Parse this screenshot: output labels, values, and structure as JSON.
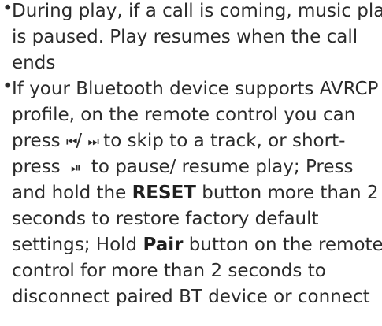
{
  "bullet_symbol": "•",
  "item1": {
    "line1": "During play, if a call is coming, music play",
    "line2": "is paused. Play resumes when the call",
    "line3": "ends"
  },
  "item2": {
    "line1": "If your Bluetooth device supports AVRCP",
    "line2": "profile, on the remote control you can",
    "line3_pre": "press ",
    "icon_prev": "⏮",
    "line3_slash": "/ ",
    "icon_next": "⏭",
    "line3_post": " to skip to a track, or short-",
    "line4_pre": "press ",
    "icon_play_pause": "⏯",
    "line4_post": "to pause/ resume play; Press",
    "line5_pre": "and hold the ",
    "line5_bold": "RESET",
    "line5_post": " button more than 2",
    "line6": "seconds to restore factory default",
    "line7_pre": "settings; Hold ",
    "line7_bold": "Pair",
    "line7_post": " button on the remote",
    "line8": "control for more than 2 seconds to",
    "line9": "disconnect paired BT device or connect"
  }
}
